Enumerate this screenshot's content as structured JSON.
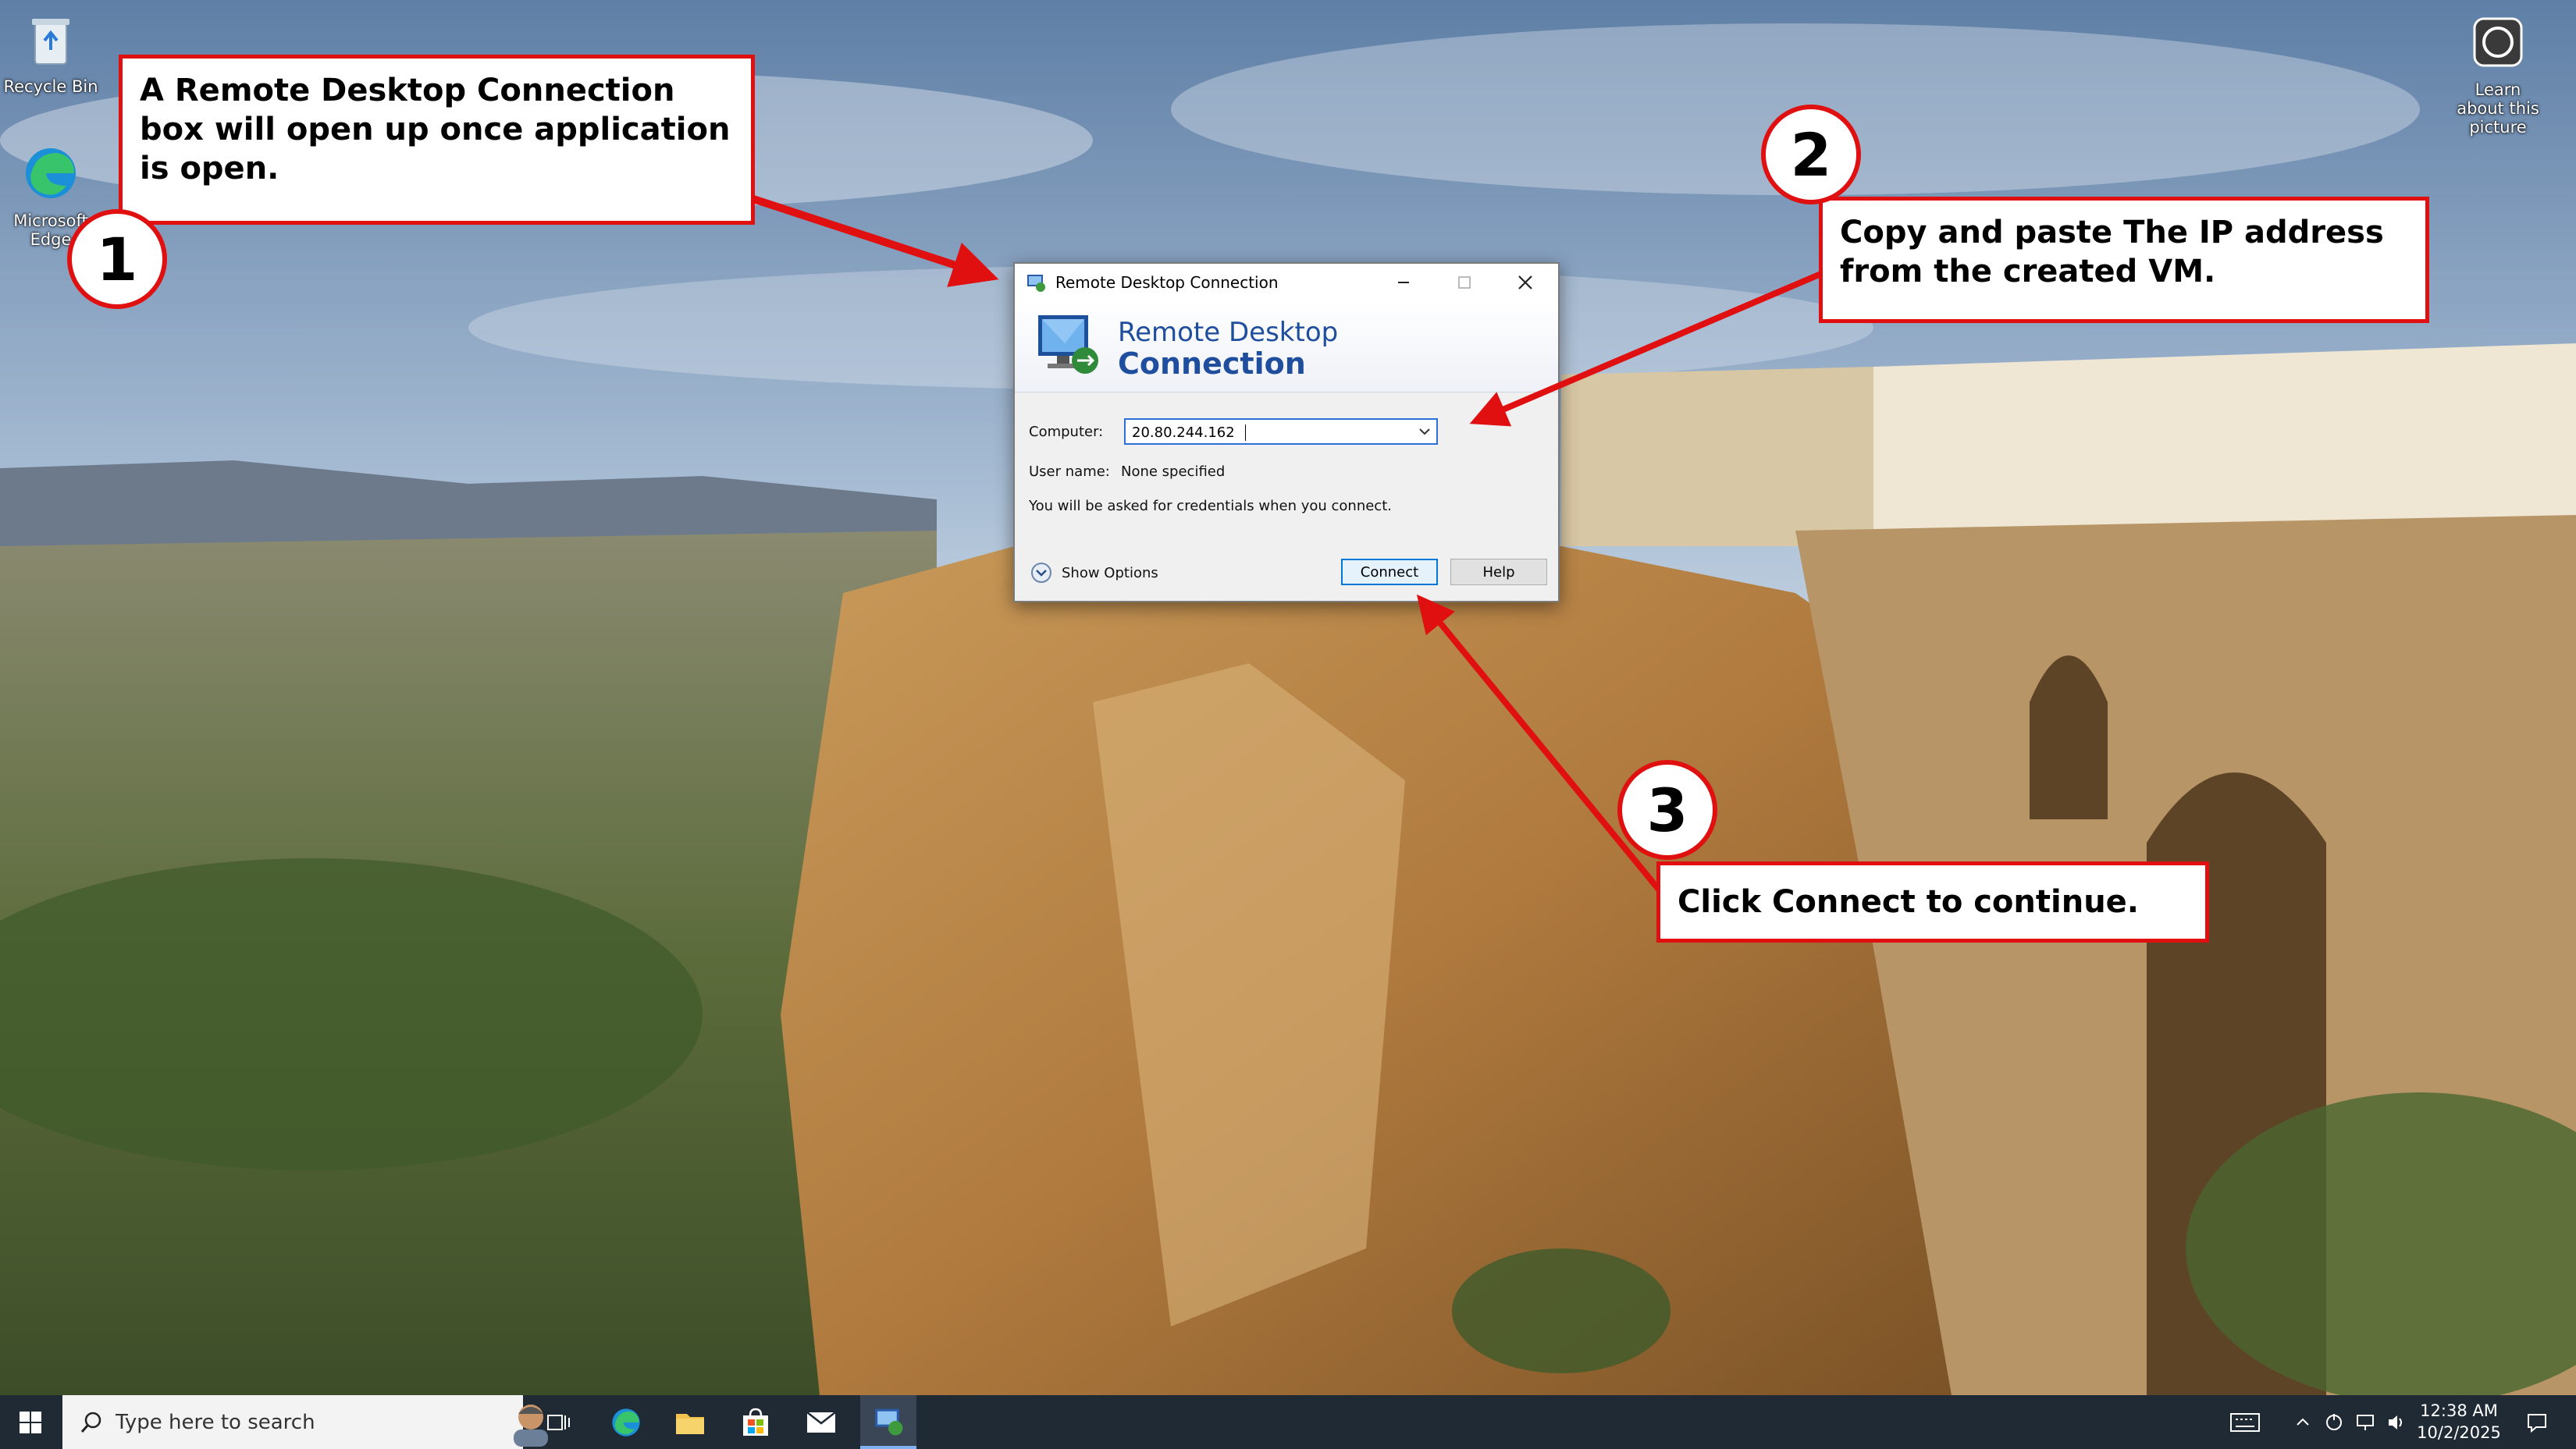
{
  "desktop": {
    "icons": [
      {
        "label": "Recycle Bin",
        "icon": "recycle-bin-icon"
      },
      {
        "label": "Microsoft Edge",
        "icon": "edge-icon"
      },
      {
        "label": "Learn about this picture",
        "icon": "camera-info-icon"
      }
    ]
  },
  "dialog": {
    "title": "Remote Desktop Connection",
    "banner_line1": "Remote Desktop",
    "banner_line2": "Connection",
    "computer_label": "Computer:",
    "computer_value": "20.80.244.162",
    "username_label": "User name:",
    "username_value": "None specified",
    "credentials_note": "You will be asked for credentials when you connect.",
    "show_options": "Show Options",
    "connect": "Connect",
    "help": "Help",
    "controls": [
      "minimize-icon",
      "maximize-icon",
      "close-icon"
    ]
  },
  "callouts": [
    {
      "number": "1",
      "text": "A Remote Desktop Connection box will open up once application is open."
    },
    {
      "number": "2",
      "text": "Copy and paste The IP address from the created VM."
    },
    {
      "number": "3",
      "text": "Click Connect to continue."
    }
  ],
  "taskbar": {
    "search_placeholder": "Type here to search",
    "time": "12:38 AM",
    "date": "10/2/2025",
    "pinned": [
      "task-view-icon",
      "edge-icon",
      "file-explorer-icon",
      "store-icon",
      "mail-icon",
      "remote-desktop-icon"
    ],
    "tray": [
      "keyboard-icon",
      "chevron-up-icon",
      "onedrive-icon",
      "network-icon",
      "volume-icon",
      "notification-icon"
    ]
  },
  "colors": {
    "callout_border": "#e01010",
    "dialog_accent": "#1f4e9e",
    "taskbar": "#1f2a35"
  }
}
